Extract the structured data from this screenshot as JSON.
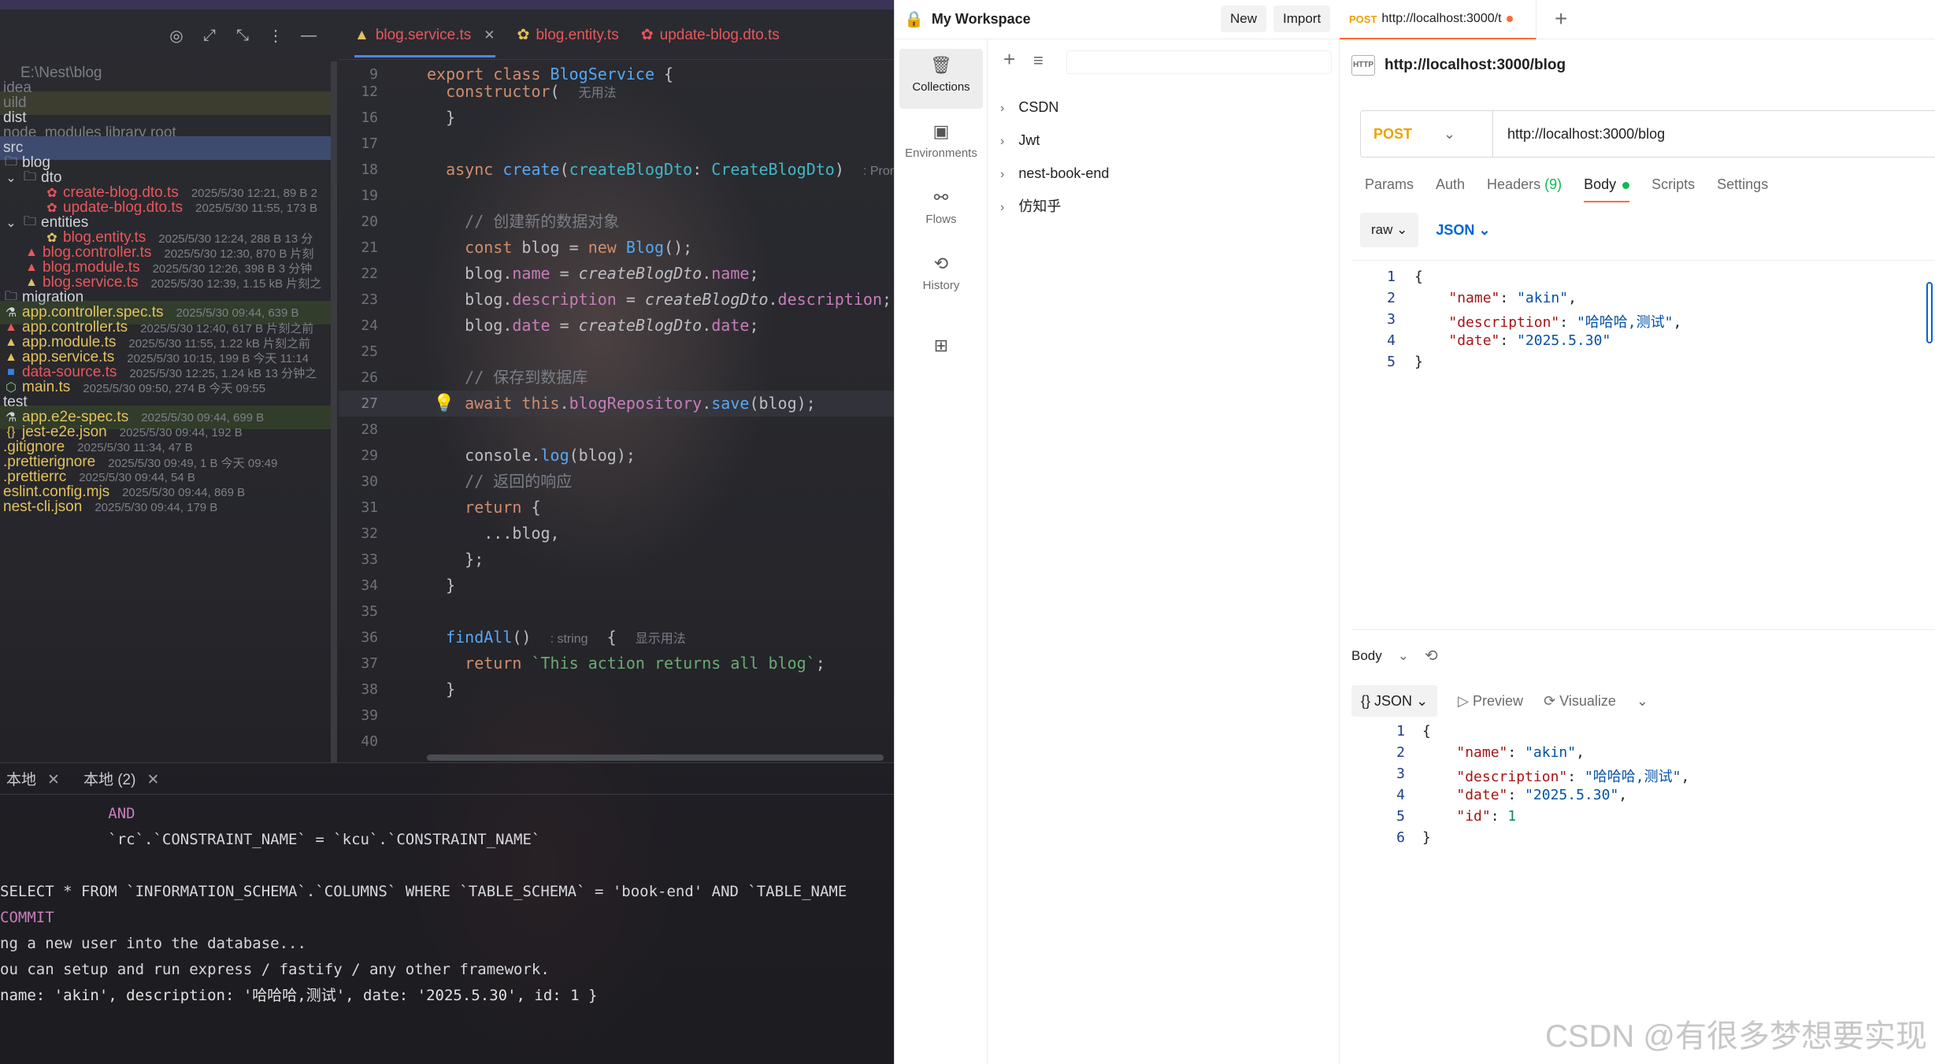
{
  "ide": {
    "toolbar_icons": [
      "target-icon",
      "expand-icon",
      "collapse-icon",
      "more-icon",
      "minimize-icon"
    ],
    "tabs": [
      {
        "label": "blog.service.ts",
        "icon": "angular-icon",
        "active": true
      },
      {
        "label": "blog.entity.ts",
        "icon": "entity-icon"
      },
      {
        "label": "update-blog.dto.ts",
        "icon": "nest-icon"
      }
    ],
    "tree": [
      {
        "label": "E:\\Nest\\blog",
        "meta": "",
        "style": "dim"
      },
      {
        "label": "idea",
        "meta": "",
        "style": "dim"
      },
      {
        "label": "uild",
        "meta": "",
        "style": "dim"
      },
      {
        "label": "dist",
        "meta": "",
        "style": ""
      },
      {
        "label": "node_modules  library root",
        "meta": "",
        "style": "dim"
      },
      {
        "label": "src",
        "meta": "",
        "style": "sel"
      },
      {
        "label": "blog",
        "meta": "",
        "style": ""
      },
      {
        "label": "dto",
        "meta": "",
        "style": ""
      },
      {
        "label": "create-blog.dto.ts",
        "meta": "2025/5/30 12:21, 89 B 2",
        "style": "red"
      },
      {
        "label": "update-blog.dto.ts",
        "meta": "2025/5/30 11:55, 173 B",
        "style": "red"
      },
      {
        "label": "entities",
        "meta": "",
        "style": ""
      },
      {
        "label": "blog.entity.ts",
        "meta": "2025/5/30 12:24, 288 B 13 分",
        "style": "red"
      },
      {
        "label": "blog.controller.ts",
        "meta": "2025/5/30 12:30, 870 B 片刻",
        "style": "red"
      },
      {
        "label": "blog.module.ts",
        "meta": "2025/5/30 12:26, 398 B 3 分钟",
        "style": "red"
      },
      {
        "label": "blog.service.ts",
        "meta": "2025/5/30 12:39, 1.15 kB 片刻之",
        "style": "red"
      },
      {
        "label": "migration",
        "meta": "",
        "style": ""
      },
      {
        "label": "app.controller.spec.ts",
        "meta": "2025/5/30 09:44, 639 B",
        "style": "yel-hl"
      },
      {
        "label": "app.controller.ts",
        "meta": "2025/5/30 12:40, 617 B 片刻之前",
        "style": "yel"
      },
      {
        "label": "app.module.ts",
        "meta": "2025/5/30 11:55, 1.22 kB 片刻之前",
        "style": "yel"
      },
      {
        "label": "app.service.ts",
        "meta": "2025/5/30 10:15, 199 B 今天 11:14",
        "style": "yel"
      },
      {
        "label": "data-source.ts",
        "meta": "2025/5/30 12:25, 1.24 kB 13 分钟之",
        "style": "red"
      },
      {
        "label": "main.ts",
        "meta": "2025/5/30 09:50, 274 B 今天 09:55",
        "style": "yel"
      },
      {
        "label": "test",
        "meta": "",
        "style": ""
      },
      {
        "label": "app.e2e-spec.ts",
        "meta": "2025/5/30 09:44, 699 B",
        "style": "yel-hl"
      },
      {
        "label": "jest-e2e.json",
        "meta": "2025/5/30 09:44, 192 B",
        "style": "yel"
      },
      {
        "label": ".gitignore",
        "meta": "2025/5/30 11:34, 47 B",
        "style": "yel"
      },
      {
        "label": ".prettierignore",
        "meta": "2025/5/30 09:49, 1 B 今天 09:49",
        "style": "yel"
      },
      {
        "label": ".prettierrc",
        "meta": "2025/5/30 09:44, 54 B",
        "style": "yel"
      },
      {
        "label": "eslint.config.mjs",
        "meta": "2025/5/30 09:44, 869 B",
        "style": "yel"
      },
      {
        "label": "nest-cli.json",
        "meta": "2025/5/30 09:44, 179 B",
        "style": "yel"
      }
    ],
    "code_lines": [
      {
        "n": "9",
        "t": "export class BlogService {"
      },
      {
        "n": "12",
        "t": "  constructor(  无用法"
      },
      {
        "n": "16",
        "t": "  }"
      },
      {
        "n": "17",
        "t": ""
      },
      {
        "n": "18",
        "t": "  async create(createBlogDto: CreateBlogDto)  : Prom"
      },
      {
        "n": "19",
        "t": ""
      },
      {
        "n": "20",
        "t": "    // 创建新的数据对象"
      },
      {
        "n": "21",
        "t": "    const blog = new Blog();"
      },
      {
        "n": "22",
        "t": "    blog.name = createBlogDto.name;"
      },
      {
        "n": "23",
        "t": "    blog.description = createBlogDto.description;"
      },
      {
        "n": "24",
        "t": "    blog.date = createBlogDto.date;"
      },
      {
        "n": "25",
        "t": ""
      },
      {
        "n": "26",
        "t": "    // 保存到数据库"
      },
      {
        "n": "27",
        "t": "    await this.blogRepository.save(blog);"
      },
      {
        "n": "28",
        "t": ""
      },
      {
        "n": "29",
        "t": "    console.log(blog);"
      },
      {
        "n": "30",
        "t": "    // 返回的响应"
      },
      {
        "n": "31",
        "t": "    return {"
      },
      {
        "n": "32",
        "t": "      ...blog,"
      },
      {
        "n": "33",
        "t": "    };"
      },
      {
        "n": "34",
        "t": "  }"
      },
      {
        "n": "35",
        "t": ""
      },
      {
        "n": "36",
        "t": "  findAll()  : string  {  显示用法"
      },
      {
        "n": "37",
        "t": "    return `This action returns all blog`;"
      },
      {
        "n": "38",
        "t": "  }"
      },
      {
        "n": "39",
        "t": ""
      },
      {
        "n": "40",
        "t": ""
      }
    ],
    "terminal_tabs": [
      {
        "label": "本地"
      },
      {
        "label": "本地 (2)"
      }
    ],
    "terminal_lines": [
      "            AND",
      "            `rc`.`CONSTRAINT_NAME` = `kcu`.`CONSTRAINT_NAME`",
      "",
      "SELECT * FROM `INFORMATION_SCHEMA`.`COLUMNS` WHERE `TABLE_SCHEMA` = 'book-end' AND `TABLE_NAME",
      "COMMIT",
      "ng a new user into the database...",
      "ou can setup and run express / fastify / any other framework.",
      "name: 'akin', description: '哈哈哈,测试', date: '2025.5.30', id: 1 }"
    ]
  },
  "postman": {
    "workspace": "My Workspace",
    "new_label": "New",
    "import_label": "Import",
    "tab_method": "POST",
    "tab_url": "http://localhost:3000/t",
    "rail": [
      {
        "label": "Collections",
        "icon": "collections-icon"
      },
      {
        "label": "Environments",
        "icon": "environments-icon"
      },
      {
        "label": "Flows",
        "icon": "flows-icon"
      },
      {
        "label": "History",
        "icon": "history-icon"
      }
    ],
    "collections": [
      "CSDN",
      "Jwt",
      "nest-book-end",
      "仿知乎"
    ],
    "request_title": "http://localhost:3000/blog",
    "method": "POST",
    "url": "http://localhost:3000/blog",
    "req_tabs": {
      "params": "Params",
      "auth": "Auth",
      "headers": "Headers",
      "headers_count": "(9)",
      "body": "Body",
      "scripts": "Scripts",
      "settings": "Settings"
    },
    "body_mode": "raw",
    "body_lang": "JSON",
    "request_body": [
      {
        "n": "1",
        "t": "{"
      },
      {
        "n": "2",
        "t": "    \"name\": \"akin\","
      },
      {
        "n": "3",
        "t": "    \"description\": \"哈哈哈,测试\","
      },
      {
        "n": "4",
        "t": "    \"date\": \"2025.5.30\""
      },
      {
        "n": "5",
        "t": "}"
      }
    ],
    "response_label": "Body",
    "response_format": "JSON",
    "preview_label": "Preview",
    "visualize_label": "Visualize",
    "response_body": [
      {
        "n": "1",
        "t": "{"
      },
      {
        "n": "2",
        "t": "    \"name\": \"akin\","
      },
      {
        "n": "3",
        "t": "    \"description\": \"哈哈哈,测试\","
      },
      {
        "n": "4",
        "t": "    \"date\": \"2025.5.30\","
      },
      {
        "n": "5",
        "t": "    \"id\": 1"
      },
      {
        "n": "6",
        "t": "}"
      }
    ],
    "watermark": "CSDN @有很多梦想要实现"
  }
}
